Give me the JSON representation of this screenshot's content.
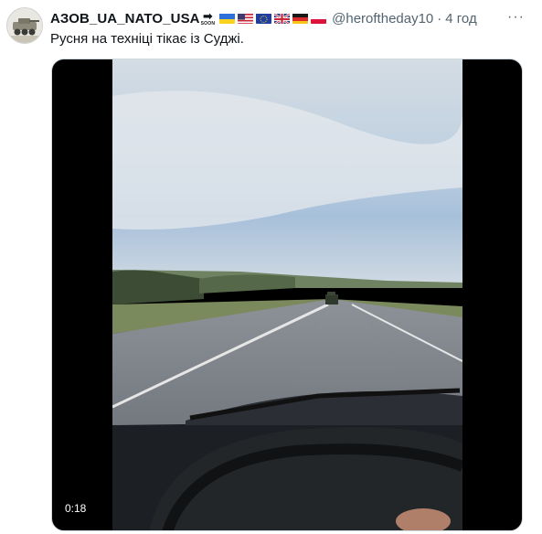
{
  "author": {
    "name": "АЗОВ_UA_NATO_USA",
    "soon_badge": "SOON",
    "flags": [
      "ukraine-flag",
      "usa-flag",
      "eu-flag",
      "uk-flag",
      "germany-flag",
      "poland-flag"
    ],
    "handle": "@heroftheday10",
    "separator": "·",
    "timestamp": "4 год"
  },
  "more_label": "···",
  "post": {
    "text": "Русня на техніці тікає із Суджі."
  },
  "media": {
    "type": "video",
    "duration": "0:18"
  }
}
